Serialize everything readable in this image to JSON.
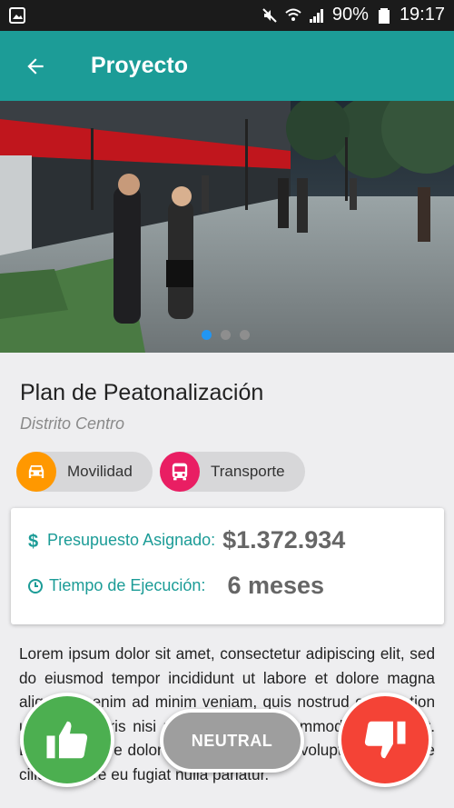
{
  "status_bar": {
    "battery": "90%",
    "time": "19:17"
  },
  "app_bar": {
    "title": "Proyecto"
  },
  "carousel": {
    "page_count": 3,
    "active_index": 0
  },
  "project": {
    "title": "Plan de Peatonalización",
    "district": "Distrito Centro",
    "categories": [
      {
        "label": "Movilidad",
        "icon": "car-icon",
        "color": "#ff9800"
      },
      {
        "label": "Transporte",
        "icon": "bus-icon",
        "color": "#e91e63"
      }
    ],
    "budget": {
      "label": "Presupuesto Asignado:",
      "value": "$1.372.934"
    },
    "time": {
      "label": "Tiempo de Ejecución:",
      "value": "6 meses"
    },
    "description": "Lorem ipsum dolor sit amet, consectetur adipiscing elit, sed do eiusmod tempor incididunt ut labore et dolore magna aliqua. Ut enim ad minim veniam, quis nostrud exercitation ullamco laboris nisi ut aliquip ex ea commodo consequat. Duis aute irure dolor in reprehenderit in voluptate velit esse cillum dolore eu fugiat nulla pariatur."
  },
  "votes": {
    "neutral_label": "NEUTRAL"
  },
  "colors": {
    "primary": "#1c9c97",
    "vote_up": "#4caf50",
    "vote_down": "#f44336",
    "neutral": "#9e9e9e"
  }
}
